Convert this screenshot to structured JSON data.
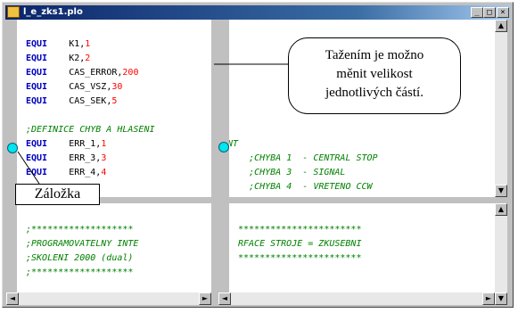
{
  "window": {
    "title": "l_e_zks1.plo",
    "minimize_glyph": "_",
    "maximize_glyph": "□",
    "close_glyph": "×"
  },
  "top_left_code": [
    {
      "kw": "EQUI",
      "id": "K1,",
      "num": "1"
    },
    {
      "kw": "EQUI",
      "id": "K2,",
      "num": "2"
    },
    {
      "kw": "EQUI",
      "id": "CAS_ERROR,",
      "num": "200"
    },
    {
      "kw": "EQUI",
      "id": "CAS_VSZ,",
      "num": "30"
    },
    {
      "kw": "EQUI",
      "id": "CAS_SEK,",
      "num": "5"
    },
    {
      "kw": "",
      "id": "",
      "num": ""
    },
    {
      "cm": ";DEFINICE CHYB A HLASENI"
    },
    {
      "kw": "EQUI",
      "id": "ERR_1,",
      "num": "1"
    },
    {
      "kw": "EQUI",
      "id": "ERR_3,",
      "num": "3"
    },
    {
      "kw": "EQUI",
      "id": "ERR_4,",
      "num": "4"
    }
  ],
  "top_right_code": [
    {
      "cm": "NT"
    },
    {
      "cm": "    ;CHYBA 1  - CENTRAL STOP"
    },
    {
      "cm": "    ;CHYBA 3  - SIGNAL"
    },
    {
      "cm": "    ;CHYBA 4  - VRETENO CCW"
    }
  ],
  "bottom_left_code": [
    {
      "cm": ";*******************"
    },
    {
      "cm": ";PROGRAMOVATELNY INTE"
    },
    {
      "cm": ";SKOLENI 2000 (dual)"
    },
    {
      "cm": ";*******************"
    }
  ],
  "bottom_right_code": [
    {
      "cm": "***********************"
    },
    {
      "cm": "RFACE STROJE = ZKUSEBNI"
    },
    {
      "cm": ""
    },
    {
      "cm": "***********************"
    }
  ],
  "callout": {
    "line1": "Tažením je možno",
    "line2": "měnit velikost",
    "line3": "jednotlivých částí."
  },
  "bookmark_label": "Záložka",
  "scroll": {
    "up": "▲",
    "down": "▼",
    "left": "◄",
    "right": "►"
  },
  "colors": {
    "keyword": "#0000c0",
    "number": "#ff0000",
    "comment": "#008000",
    "bookmark": "#00e5ee"
  }
}
